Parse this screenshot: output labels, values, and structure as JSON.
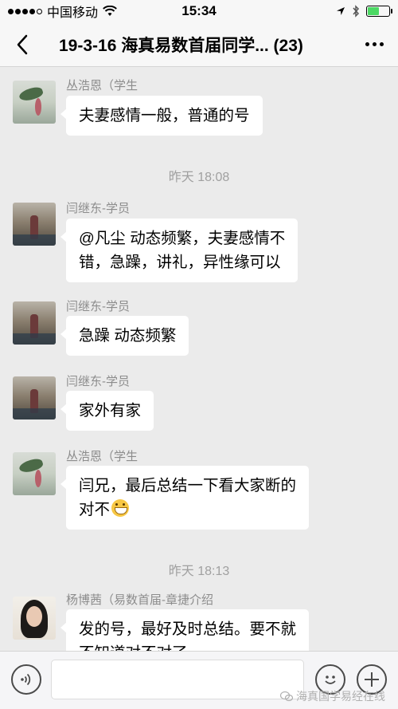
{
  "status_bar": {
    "carrier": "中国移动",
    "time": "15:34",
    "battery_level": 0.55
  },
  "header": {
    "title": "19-3-16 海真易数首届同学... (23)",
    "back_icon": "chevron-left-icon",
    "more_icon": "more-dots-icon"
  },
  "messages": [
    {
      "sender": "丛浩恩（学生",
      "lines": [
        "夫妻感情一般，普通的号"
      ],
      "avatar": "lotus"
    },
    {
      "timestamp": "昨天 18:08"
    },
    {
      "sender": "闫继东-学员",
      "lines": [
        "@凡尘 动态频繁，夫妻感情不",
        "错，急躁，讲礼，异性缘可以"
      ],
      "avatar": "mall"
    },
    {
      "sender": "闫继东-学员",
      "lines": [
        "急躁 动态频繁"
      ],
      "avatar": "mall"
    },
    {
      "sender": "闫继东-学员",
      "lines": [
        "家外有家"
      ],
      "avatar": "mall"
    },
    {
      "sender": "丛浩恩（学生",
      "lines": [
        "闫兄，最后总结一下看大家断的",
        "对不"
      ],
      "emoji": "grinning-face-icon",
      "avatar": "lotus"
    },
    {
      "timestamp": "昨天 18:13"
    },
    {
      "sender": "杨博茜（易数首届-章捷介绍",
      "lines": [
        "发的号，最好及时总结。要不就",
        "不知道对不对了"
      ],
      "avatar": "woman"
    }
  ],
  "input_bar": {
    "voice_icon": "voice-icon",
    "emoji_icon": "emoji-icon",
    "plus_icon": "plus-icon"
  },
  "watermark": {
    "text": "海真国学易经在线"
  }
}
